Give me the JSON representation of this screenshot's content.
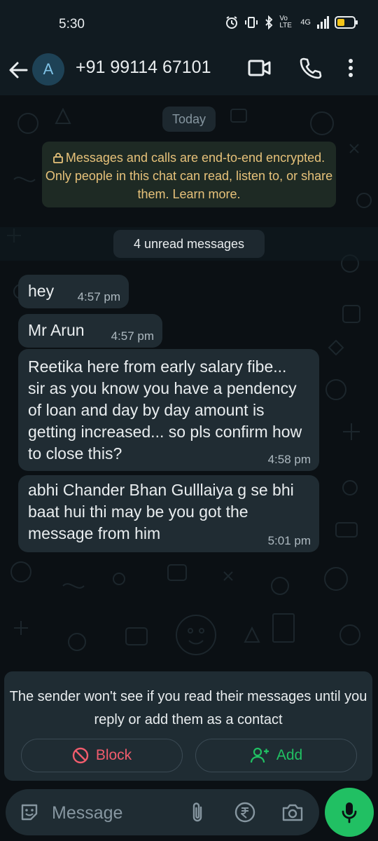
{
  "status_bar": {
    "time": "5:30",
    "network": "4G",
    "volte": "Vo LTE"
  },
  "header": {
    "avatar_letter": "A",
    "contact": "+91 99114 67101"
  },
  "chat": {
    "date_label": "Today",
    "encryption_notice": "Messages and calls are end-to-end encrypted. Only people in this chat can read, listen to, or share them. Learn more.",
    "unread_label": "4 unread messages",
    "messages": [
      {
        "text": "hey",
        "time": "4:57 pm"
      },
      {
        "text": "Mr Arun",
        "time": "4:57 pm"
      },
      {
        "text": "Reetika here from early salary fibe... sir as you know you have a pendency of loan and day by day amount is getting increased... so pls confirm how to close this?",
        "time": "4:58 pm"
      },
      {
        "text": "abhi Chander Bhan Gulllaiya g se bhi baat hui thi may be you got the message from him",
        "time": "5:01 pm"
      }
    ]
  },
  "notice": {
    "text": "The sender won't see if you read their messages until you reply or add them as a contact",
    "block_label": "Block",
    "add_label": "Add"
  },
  "composer": {
    "placeholder": "Message"
  },
  "colors": {
    "accent_green": "#21c063",
    "danger_red": "#f15c6d",
    "bubble": "#202c33",
    "encryption_text": "#e7c27a"
  },
  "icons": [
    "back-arrow-icon",
    "video-call-icon",
    "phone-icon",
    "more-vert-icon",
    "lock-icon",
    "block-icon",
    "add-contact-icon",
    "sticker-icon",
    "attach-icon",
    "rupee-icon",
    "camera-icon",
    "mic-icon"
  ]
}
